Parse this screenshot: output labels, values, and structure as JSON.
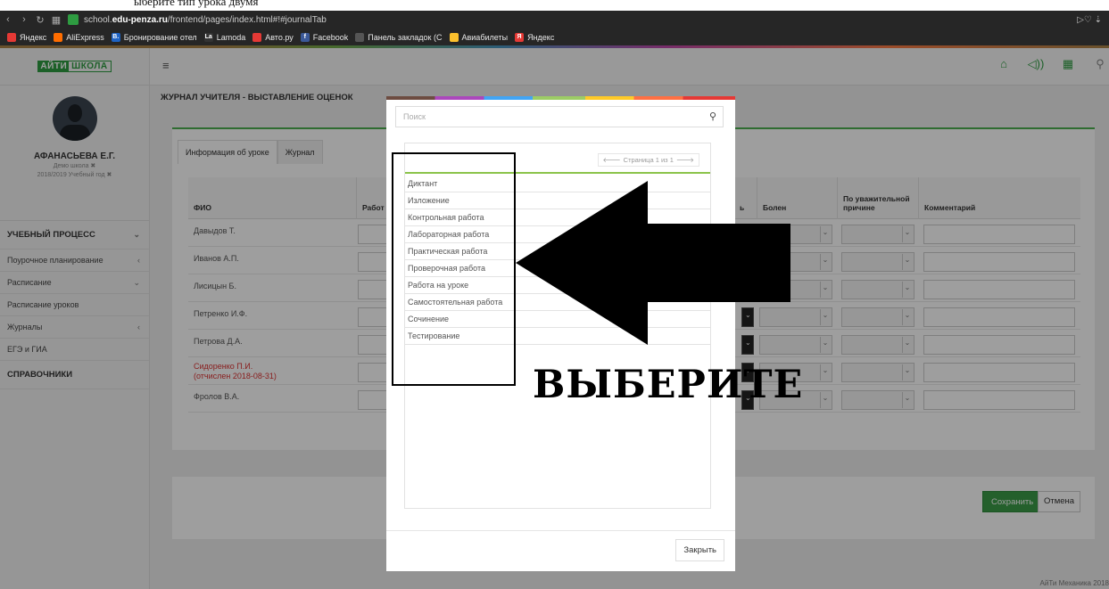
{
  "caption": "ыберите тип урока двумя",
  "browser": {
    "url_prefix": "school.",
    "url_domain": "edu-penza.ru",
    "url_path": "/frontend/pages/index.html#!#journalTab",
    "bookmarks": [
      {
        "label": "Яндекс",
        "icon": "yandex-icon",
        "color": "#e53935",
        "glyph": ""
      },
      {
        "label": "AliExpress",
        "icon": "aliexpress-icon",
        "color": "#ff6d00",
        "glyph": ""
      },
      {
        "label": "Бронирование отел",
        "icon": "booking-icon",
        "color": "#1e63c4",
        "glyph": "B."
      },
      {
        "label": "Lamoda",
        "icon": "lamoda-icon",
        "color": "#333333",
        "glyph": "La"
      },
      {
        "label": "Авто.ру",
        "icon": "autoru-icon",
        "color": "#e53935",
        "glyph": ""
      },
      {
        "label": "Facebook",
        "icon": "facebook-icon",
        "color": "#3b5998",
        "glyph": "f"
      },
      {
        "label": "Панель закладок (С",
        "icon": "folder-icon",
        "color": "#555555",
        "glyph": ""
      },
      {
        "label": "Авиабилеты",
        "icon": "plane-icon",
        "color": "#fbc02d",
        "glyph": ""
      },
      {
        "label": "Яндекс",
        "icon": "yandex-icon",
        "color": "#e53935",
        "glyph": "Я"
      }
    ]
  },
  "sidebar": {
    "logo_a": "АЙТИ",
    "logo_b": "ШКОЛА",
    "user_name": "АФАНАСЬЕВА Е.Г.",
    "user_school": "Демо школа ✖",
    "user_year": "2018/2019 Учебный год ✖",
    "menu": [
      {
        "label": "УЧЕБНЫЙ ПРОЦЕСС",
        "chev": "⌄",
        "hdr": true
      },
      {
        "label": "Поурочное планирование",
        "chev": "‹",
        "hdr": false
      },
      {
        "label": "Расписание",
        "chev": "⌄",
        "hdr": false
      },
      {
        "label": "Расписание уроков",
        "chev": "",
        "hdr": false
      },
      {
        "label": "Журналы",
        "chev": "‹",
        "hdr": false
      },
      {
        "label": "ЕГЭ и ГИА",
        "chev": "",
        "hdr": false
      },
      {
        "label": "СПРАВОЧНИКИ",
        "chev": "",
        "hdr": true
      }
    ]
  },
  "page": {
    "title": "ЖУРНАЛ УЧИТЕЛЯ - ВЫСТАВЛЕНИЕ ОЦЕНОК",
    "tabs": [
      "Информация об уроке",
      "Журнал"
    ],
    "columns": {
      "fio": "ФИО",
      "work": "Работ",
      "ill_suffix": "ь",
      "sick": "Болен",
      "reason": "По уважительной причине",
      "comment": "Комментарий"
    },
    "students": [
      {
        "name": "Давыдов Т.",
        "expelled": false
      },
      {
        "name": "Иванов А.П.",
        "expelled": false
      },
      {
        "name": "Лисицын Б.",
        "expelled": false
      },
      {
        "name": "Петренко И.Ф.",
        "expelled": false
      },
      {
        "name": "Петрова Д.А.",
        "expelled": false
      },
      {
        "name": "Сидоренко П.И.",
        "note": "(отчислен 2018-08-31)",
        "expelled": true
      },
      {
        "name": "Фролов В.А.",
        "expelled": false
      }
    ],
    "save_label": "Сохранить",
    "cancel_label": "Отмена",
    "footer": "АйТи Механика 2018"
  },
  "modal": {
    "search_placeholder": "Поиск",
    "pager_text": "Страница 1 из 1",
    "options": [
      "Диктант",
      "Изложение",
      "Контрольная работа",
      "Лабораторная работа",
      "Практическая работа",
      "Проверочная работа",
      "Работа на уроке",
      "Самостоятельная работа",
      "Сочинение",
      "Тестирование"
    ],
    "close_label": "Закрыть"
  },
  "annotation": {
    "text": "ВЫБЕРИТЕ"
  },
  "colors": {
    "accent": "#2e9c41",
    "expelled": "#dd3333"
  }
}
